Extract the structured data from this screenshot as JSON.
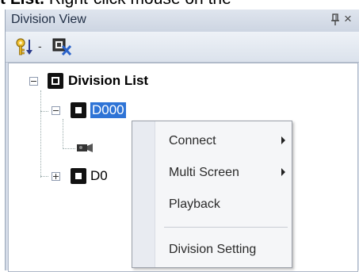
{
  "caption": {
    "bold": "t List.",
    "rest": " Right-click mouse on the"
  },
  "panel": {
    "title": "Division View",
    "pin_icon": "pin-icon",
    "close_glyph": "×"
  },
  "toolbar": {
    "key_icon": "key-sort-icon",
    "dropdown_glyph": "-",
    "remove_icon": "remove-division-icon"
  },
  "tree": {
    "root_label": "Division List",
    "child1_label": "D000",
    "child2_label": "D0"
  },
  "context_menu": {
    "items": [
      {
        "label": "Connect",
        "has_submenu": true
      },
      {
        "label": "Multi Screen",
        "has_submenu": true
      },
      {
        "label": "Playback",
        "has_submenu": false
      },
      {
        "label": "Division Setting",
        "has_submenu": false
      }
    ]
  },
  "colors": {
    "selection": "#2f74d6",
    "panel_bg": "#d5dce8",
    "menu_bg": "#f5f6f8"
  }
}
